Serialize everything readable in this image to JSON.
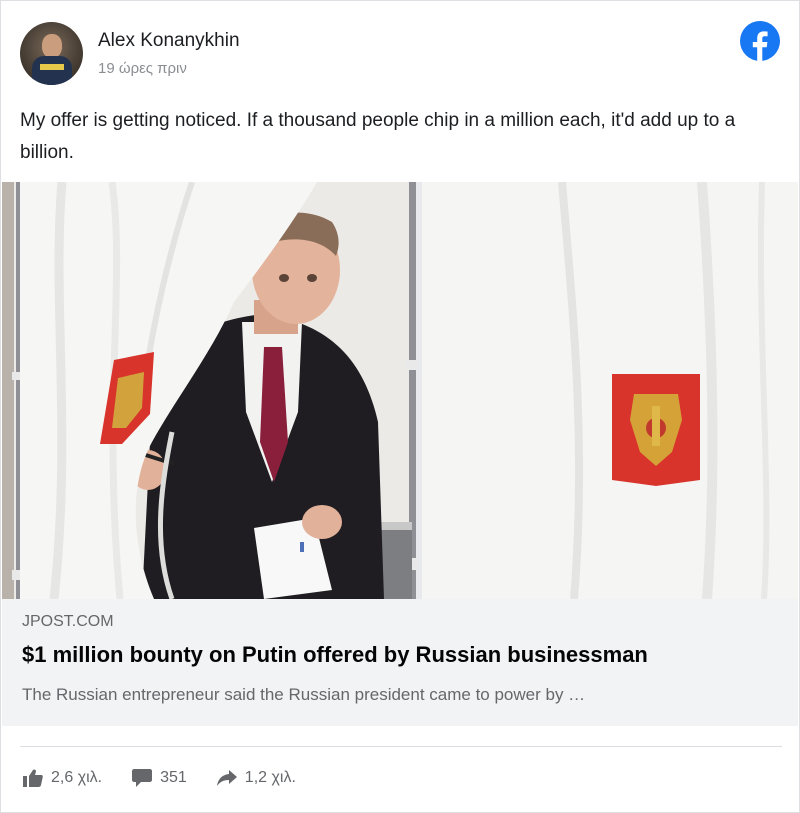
{
  "post": {
    "author": "Alex Konanykhin",
    "timestamp": "19 ώρες πριν",
    "text": "My offer is getting noticed. If a thousand people chip in a million each, it'd add up to a billion."
  },
  "link_preview": {
    "domain": "JPOST.COM",
    "headline": "$1 million bounty on Putin offered by Russian businessman",
    "description": "The Russian entrepreneur said the Russian president came to power by …"
  },
  "stats": {
    "likes": "2,6 χιλ.",
    "comments": "351",
    "shares": "1,2 χιλ."
  },
  "colors": {
    "facebook_blue": "#1877f2",
    "preview_background": "#f2f3f5",
    "muted_text": "#65676b"
  },
  "icons": {
    "brand": "facebook-logo-icon",
    "like": "thumbs-up-icon",
    "comment": "speech-bubble-icon",
    "share": "share-arrow-icon"
  }
}
